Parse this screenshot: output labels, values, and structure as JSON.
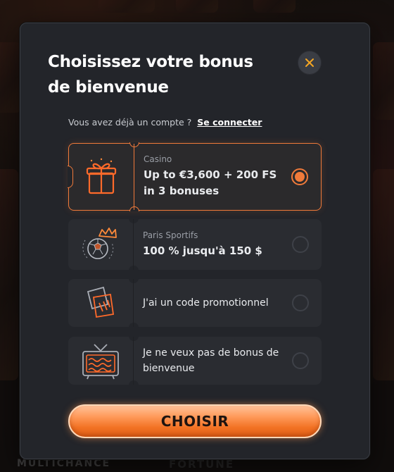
{
  "background": {
    "tile_text_left": "MULTICHANCE",
    "tile_text_center": "FORTUNE"
  },
  "modal": {
    "title": "Choisissez votre bonus de bienvenue",
    "login_prompt": "Vous avez déjà un compte ?",
    "login_link": "Se connecter",
    "close_icon": "close-icon",
    "accent_color": "#f07a3a",
    "options": [
      {
        "category": "Casino",
        "label": "Up to €3,600 + 200 FS in 3 bonuses",
        "icon": "gift-icon",
        "selected": true
      },
      {
        "category": "Paris Sportifs",
        "label": "100 % jusqu'à 150 $",
        "icon": "soccer-ball-crown-icon",
        "selected": false
      },
      {
        "category": "",
        "label": "J'ai un code promotionnel",
        "icon": "tickets-icon",
        "selected": false
      },
      {
        "category": "",
        "label": "Je ne veux pas de bonus de bienvenue",
        "icon": "tv-icon",
        "selected": false
      }
    ],
    "submit_label": "CHOISIR"
  }
}
